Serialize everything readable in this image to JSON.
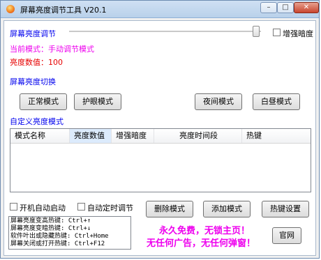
{
  "window": {
    "title": "屏幕亮度调节工具 V20.1",
    "controls": {
      "minimize": "–",
      "maximize": "□",
      "close": "✕"
    }
  },
  "brightness": {
    "label": "屏幕亮度调节",
    "enhance_checkbox": {
      "label": "增强暗度",
      "checked": false
    },
    "current_mode_text": "当前模式：手动调节模式",
    "value_text": "亮度数值：100",
    "slider_level_percent": 97
  },
  "mode_switch": {
    "label": "屏幕亮度切换",
    "buttons": [
      "正常模式",
      "护眼模式",
      "夜间模式",
      "白昼模式"
    ]
  },
  "custom_modes": {
    "label": "自定义亮度模式",
    "columns": [
      "模式名称",
      "亮度数值",
      "增强暗度",
      "亮度时间段",
      "热键"
    ],
    "rows": []
  },
  "options": {
    "auto_start": {
      "label": "开机自动启动",
      "checked": false
    },
    "auto_timer": {
      "label": "自动定时调节",
      "checked": false
    }
  },
  "actions": {
    "delete": "删除模式",
    "add": "添加模式",
    "hotkeys": "热键设置"
  },
  "hotkeys_info": [
    "屏幕亮度变高热键: Ctrl+↑",
    "屏幕亮度变暗热键: Ctrl+↓",
    "软件叶出或隐藏热键: Ctrl+Home",
    "屏幕关闭或打开热键: Ctrl+F12"
  ],
  "promo": {
    "line1": "永久免费，无锁主页！",
    "line2": "无任何广告，无任何弹窗！"
  },
  "website_button": "官网",
  "colors": {
    "label_blue": "#0000ee",
    "status_magenta": "#ee00ee",
    "value_red": "#e60000"
  }
}
